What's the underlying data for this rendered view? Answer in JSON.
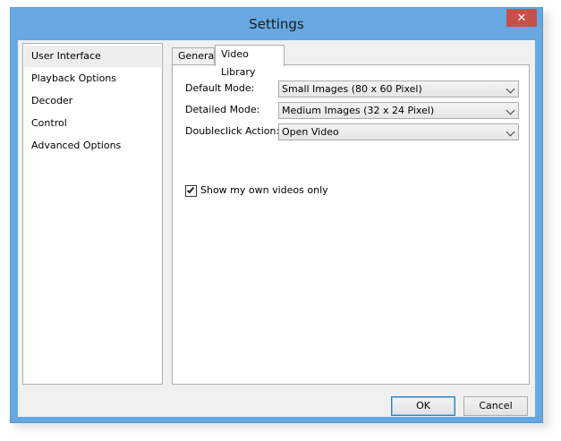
{
  "window": {
    "title": "Settings",
    "close_glyph": "✕"
  },
  "sidebar": {
    "items": [
      {
        "label": "User Interface",
        "selected": true
      },
      {
        "label": "Playback Options",
        "selected": false
      },
      {
        "label": "Decoder",
        "selected": false
      },
      {
        "label": "Control",
        "selected": false
      },
      {
        "label": "Advanced Options",
        "selected": false
      }
    ]
  },
  "tabs": [
    {
      "label": "General",
      "active": false
    },
    {
      "label": "Video Library",
      "active": true
    }
  ],
  "video_library": {
    "default_mode": {
      "label": "Default Mode:",
      "value": "Small Images (80 x 60 Pixel)"
    },
    "detailed_mode": {
      "label": "Detailed Mode:",
      "value": "Medium Images (32 x 24 Pixel)"
    },
    "doubleclick_action": {
      "label": "Doubleclick Action:",
      "value": "Open Video"
    },
    "own_videos_only": {
      "label": "Show my own videos only",
      "checked": true
    }
  },
  "buttons": {
    "ok": "OK",
    "cancel": "Cancel"
  },
  "colors": {
    "frame": "#67a8e2",
    "close": "#c7504a",
    "selected_item": "#ededed"
  }
}
